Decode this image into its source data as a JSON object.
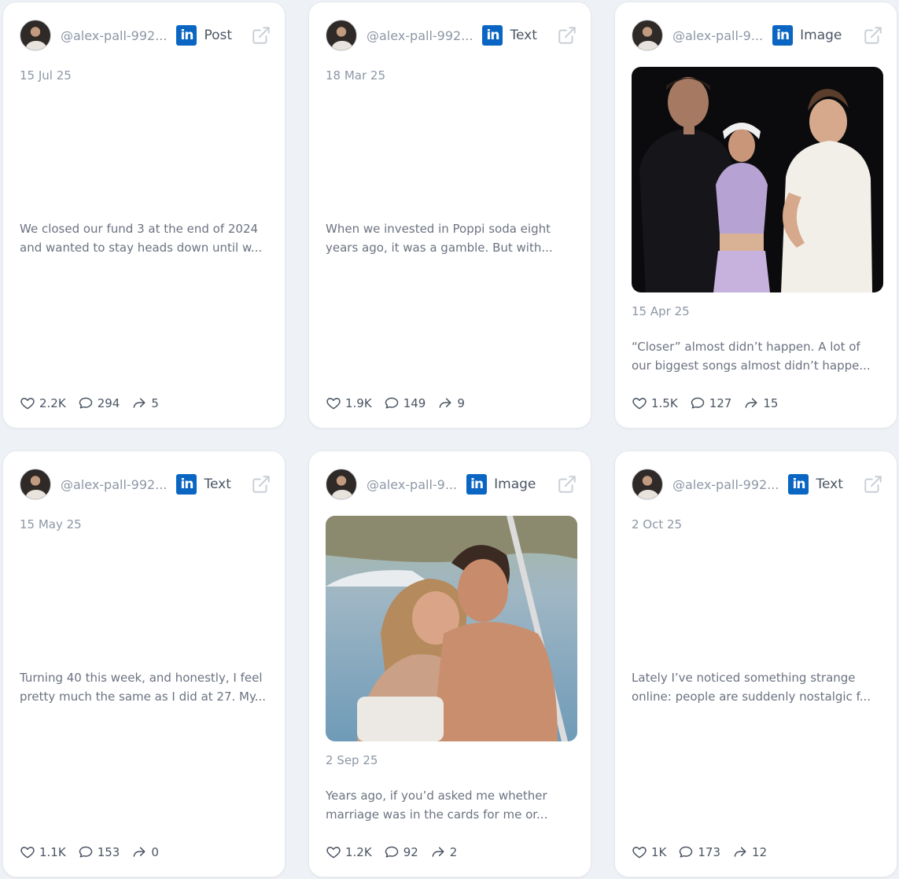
{
  "cards": [
    {
      "handle": "@alex-pall-992...",
      "network_icon": "linkedin-icon",
      "type": "Post",
      "date": "15 Jul 25",
      "text": "We closed our fund 3 at the end of 2024 and wanted to stay heads down until w...",
      "likes": "2.2K",
      "comments": "294",
      "shares": "5"
    },
    {
      "handle": "@alex-pall-992...",
      "network_icon": "linkedin-icon",
      "type": "Text",
      "date": "18 Mar 25",
      "text": "When we invested in Poppi soda eight years ago, it was a gamble. But with...",
      "likes": "1.9K",
      "comments": "149",
      "shares": "9"
    },
    {
      "handle": "@alex-pall-9...",
      "network_icon": "linkedin-icon",
      "type": "Image",
      "date": "15 Apr 25",
      "text": "“Closer” almost didn’t happen. A lot of our biggest songs almost didn’t happe...",
      "likes": "1.5K",
      "comments": "127",
      "shares": "15"
    },
    {
      "handle": "@alex-pall-992...",
      "network_icon": "linkedin-icon",
      "type": "Text",
      "date": "15 May 25",
      "text": "Turning 40 this week, and honestly, I feel pretty much the same as I did at 27. My...",
      "likes": "1.1K",
      "comments": "153",
      "shares": "0"
    },
    {
      "handle": "@alex-pall-9...",
      "network_icon": "linkedin-icon",
      "type": "Image",
      "date": "2 Sep 25",
      "text": "Years ago, if you’d asked me whether marriage was in the cards for me or...",
      "likes": "1.2K",
      "comments": "92",
      "shares": "2"
    },
    {
      "handle": "@alex-pall-992...",
      "network_icon": "linkedin-icon",
      "type": "Text",
      "date": "2 Oct 25",
      "text": "Lately I’ve noticed something strange online: people are suddenly nostalgic f...",
      "likes": "1K",
      "comments": "173",
      "shares": "12"
    }
  ],
  "colors": {
    "background": "#eef1f5",
    "card": "#ffffff",
    "linkedin": "#0a66c2",
    "muted_text": "#8d97a5",
    "body_text": "#6b7280"
  }
}
